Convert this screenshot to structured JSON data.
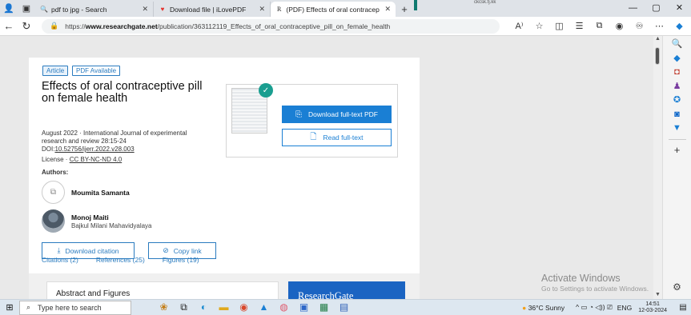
{
  "browser": {
    "tabs": [
      {
        "title": "pdf to jpg - Search",
        "icon": "search-icon",
        "active": false
      },
      {
        "title": "Download file | iLovePDF",
        "icon": "heart-icon",
        "active": false
      },
      {
        "title": "(PDF) Effects of oral contraceptiv",
        "icon": "researchgate-icon",
        "active": true
      }
    ],
    "new_tab": "+",
    "url_prefix": "https://",
    "url_host": "www.researchgate.net",
    "url_path": "/publication/363112119_Effects_of_oral_contraceptive_pill_on_female_health",
    "window_controls": {
      "minimize": "—",
      "maximize": "▢",
      "close": "✕"
    },
    "top_text": "ckcsk.fj.kk"
  },
  "publication": {
    "badge_type": "Article",
    "badge_pdf": "PDF Available",
    "title": "Effects of oral contraceptive pill on female health",
    "date_journal": "August 2022 · International Journal of experimental research and review 28:15-24",
    "doi_label": "DOI:",
    "doi": "10.52756/ijerr.2022.v28.003",
    "license_label": "License · ",
    "license": "CC BY-NC-ND 4.0",
    "authors_label": "Authors:",
    "authors": [
      {
        "name": "Moumita Samanta",
        "affiliation": ""
      },
      {
        "name": "Monoj Maiti",
        "affiliation": "Bajkul Milani Mahavidyalaya"
      }
    ],
    "download_citation": "Download citation",
    "copy_link": "Copy link",
    "download_pdf": "Download full-text PDF",
    "read_fulltext": "Read full-text",
    "tabs": [
      "Citations (2)",
      "References (25)",
      "Figures (19)"
    ],
    "abstract_title": "Abstract and Figures",
    "rg_brand": "ResearchGate"
  },
  "watermark": {
    "line1": "Activate Windows",
    "line2": "Go to Settings to activate Windows."
  },
  "taskbar": {
    "search_placeholder": "Type here to search",
    "weather": "36°C  Sunny",
    "lang": "ENG",
    "time": "14:51",
    "date": "12-03-2024"
  },
  "colors": {
    "accent": "#1a7fd4",
    "researchgate_teal": "#1a9e90",
    "link_blue": "#2a7bbf"
  }
}
